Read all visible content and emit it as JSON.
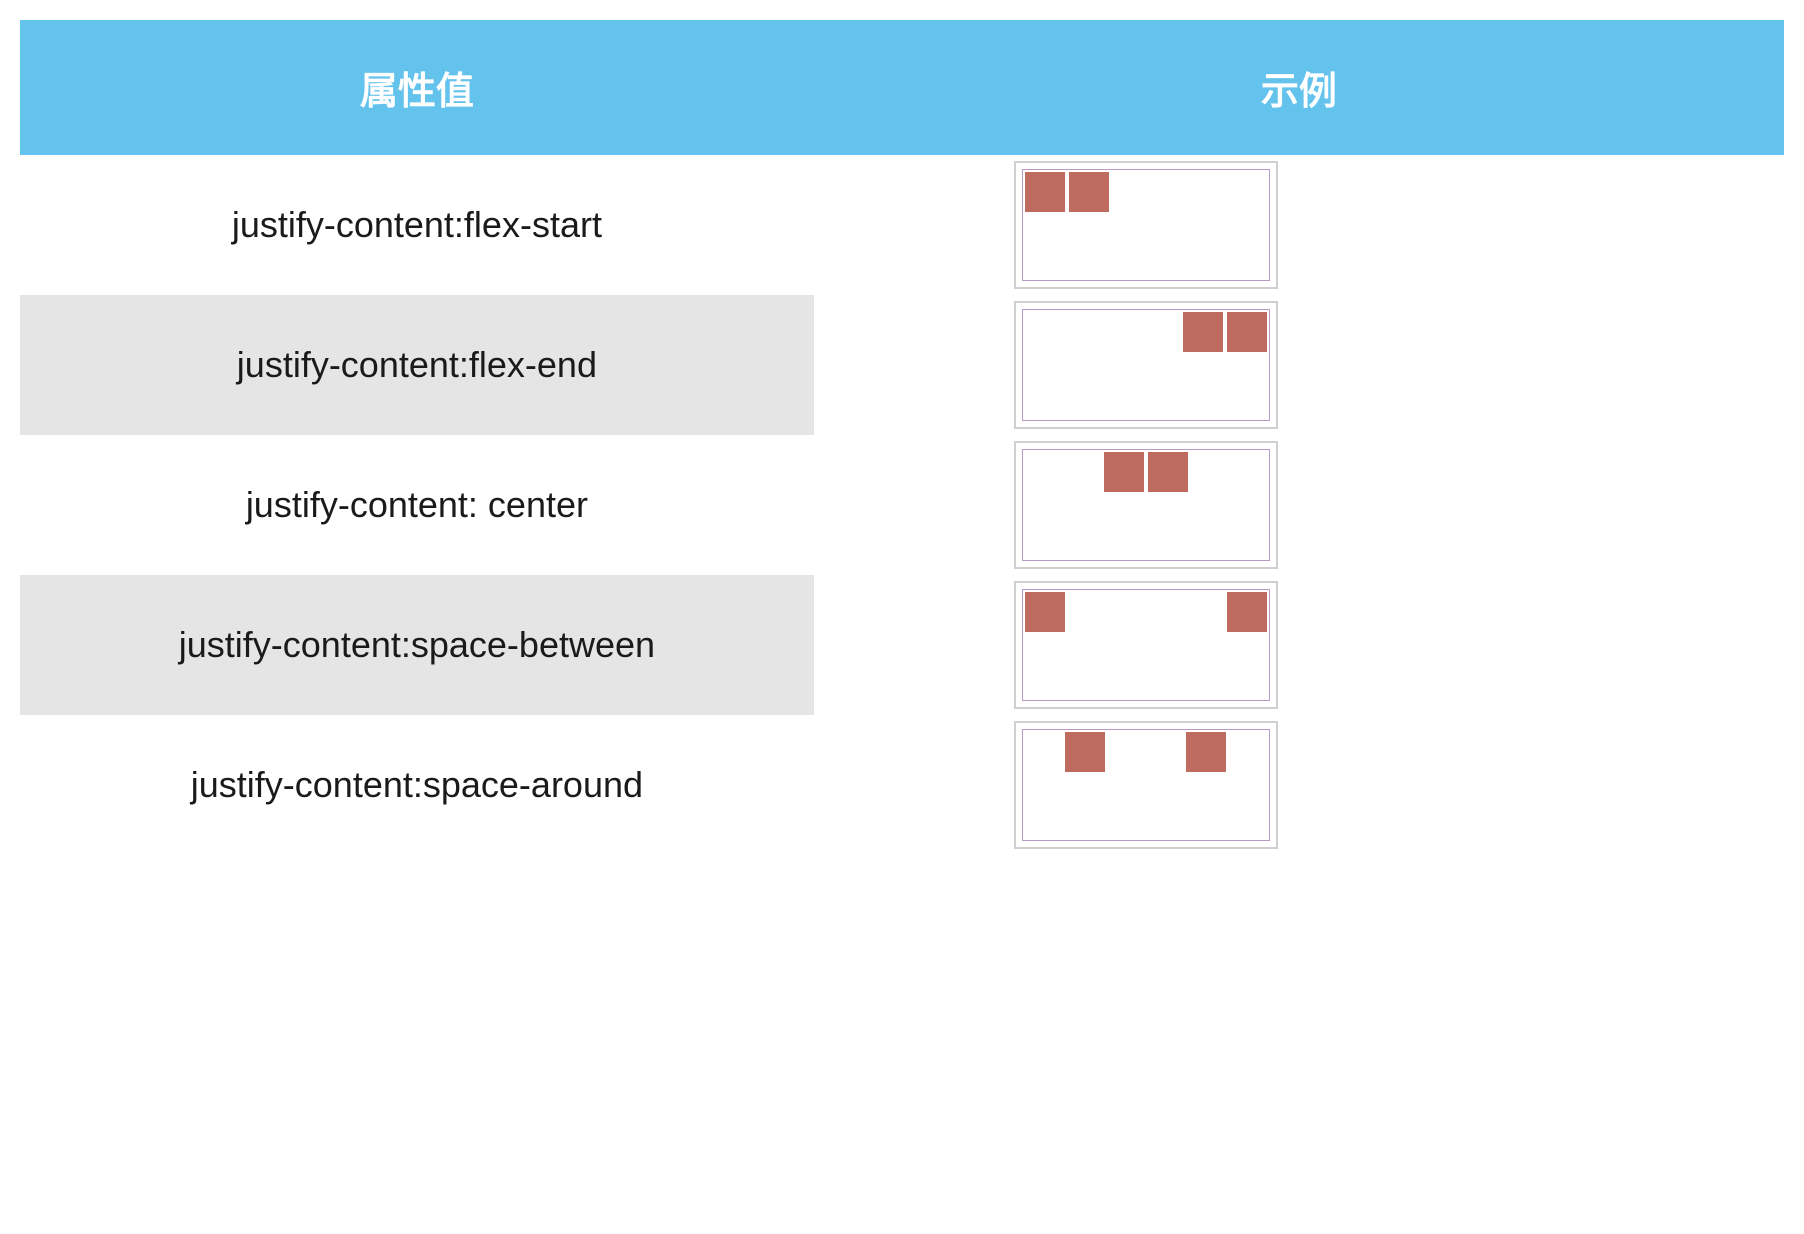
{
  "header": {
    "col1": "属性值",
    "col2": "示例"
  },
  "rows": [
    {
      "label": "justify-content:flex-start",
      "jc": "flex-start",
      "alt": false
    },
    {
      "label": "justify-content:flex-end",
      "jc": "flex-end",
      "alt": true
    },
    {
      "label": "justify-content: center",
      "jc": "center",
      "alt": false
    },
    {
      "label": "justify-content:space-between",
      "jc": "space-between",
      "alt": true
    },
    {
      "label": "justify-content:space-around",
      "jc": "space-around",
      "alt": false
    }
  ]
}
